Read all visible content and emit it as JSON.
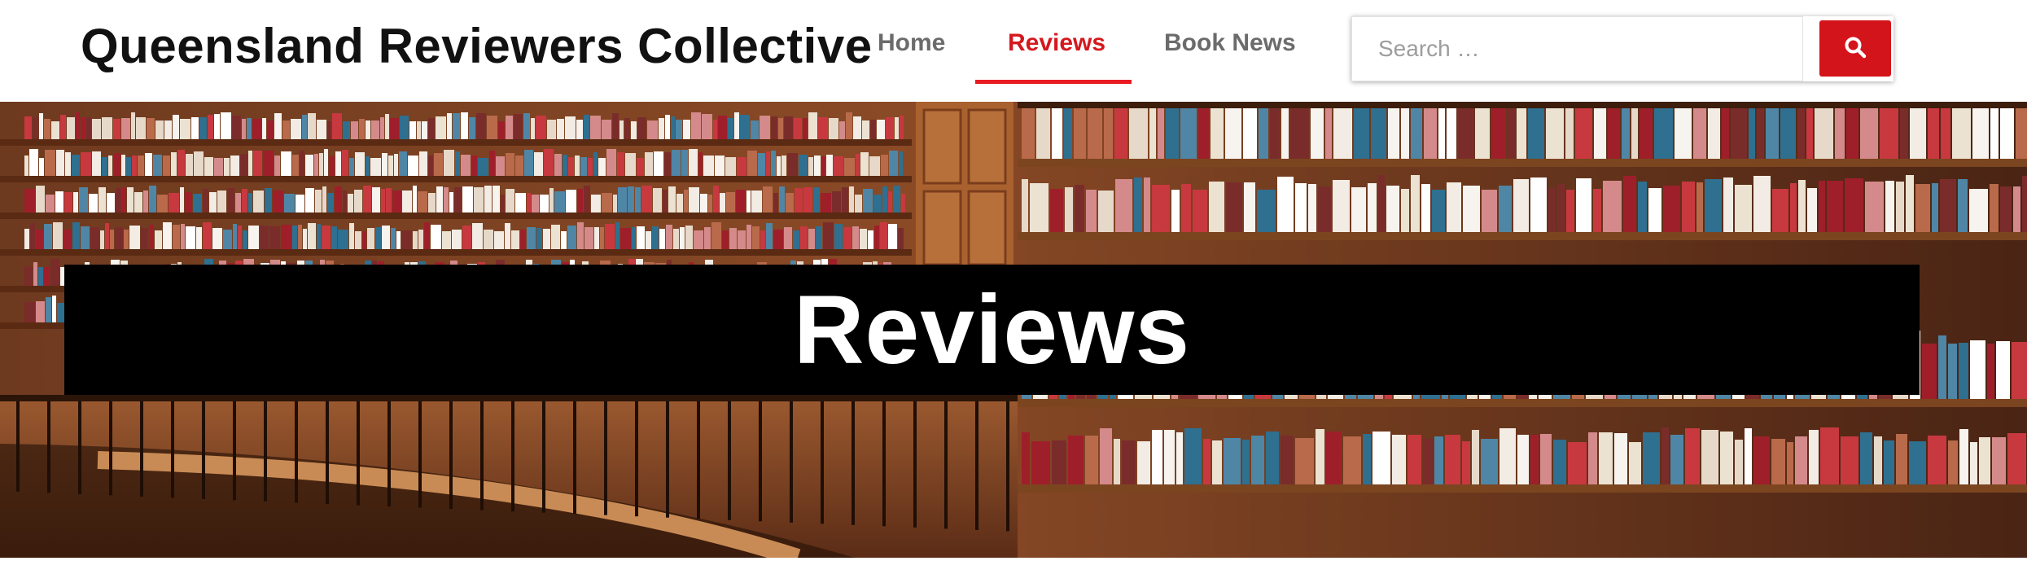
{
  "header": {
    "site_title": "Queensland Reviewers Collective",
    "nav": [
      {
        "label": "Home",
        "active": false
      },
      {
        "label": "Reviews",
        "active": true
      },
      {
        "label": "Book News",
        "active": false
      }
    ],
    "search": {
      "placeholder": "Search …",
      "value": "",
      "button_icon": "search-icon"
    }
  },
  "hero": {
    "image": "library-bookshelves-photo",
    "title": "Reviews"
  },
  "colors": {
    "accent": "#d4141b",
    "nav_text": "#6b6b6b",
    "banner_bg": "#000000"
  }
}
